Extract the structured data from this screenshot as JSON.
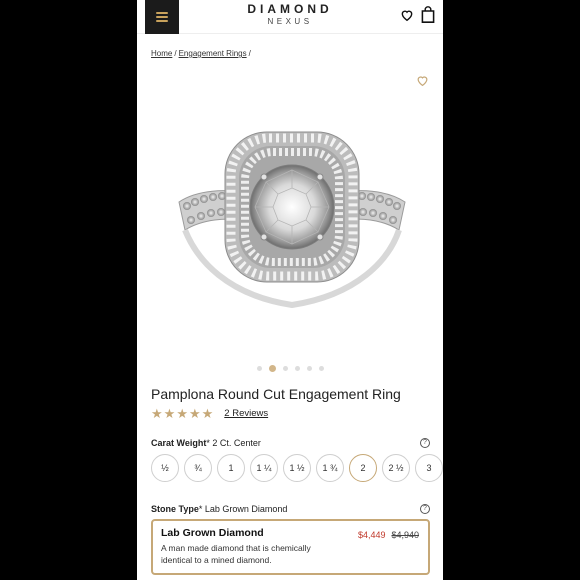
{
  "header": {
    "brand_line1": "DIAMOND",
    "brand_line2": "NEXUS",
    "menu_icon": "hamburger-icon",
    "wishlist_icon": "heart-icon",
    "bag_icon": "shopping-bag-icon"
  },
  "breadcrumb": {
    "items": [
      "Home",
      "Engagement Rings"
    ],
    "separator": "/"
  },
  "gallery": {
    "slide_count": 6,
    "active_index": 1
  },
  "product": {
    "title": "Pamplona Round Cut Engagement Ring",
    "rating": 5,
    "reviews_label": "2 Reviews"
  },
  "carat": {
    "label": "Carat Weight",
    "required_mark": "*",
    "selected_text": "2 Ct. Center",
    "options": [
      "½",
      "¾",
      "1",
      "1 ¼",
      "1 ½",
      "1 ¾",
      "2",
      "2 ½",
      "3"
    ],
    "selected": "2"
  },
  "stone": {
    "label": "Stone Type",
    "required_mark": "*",
    "selected_text": "Lab Grown Diamond",
    "card": {
      "name": "Lab Grown Diamond",
      "description": "A man made diamond that is chemically identical to a mined diamond.",
      "price": "$4,449",
      "original_price": "$4,940"
    }
  },
  "colors": {
    "accent_gold": "#c6a877",
    "sale_red": "#c0392b",
    "menu_bg": "#1b1b1b"
  }
}
